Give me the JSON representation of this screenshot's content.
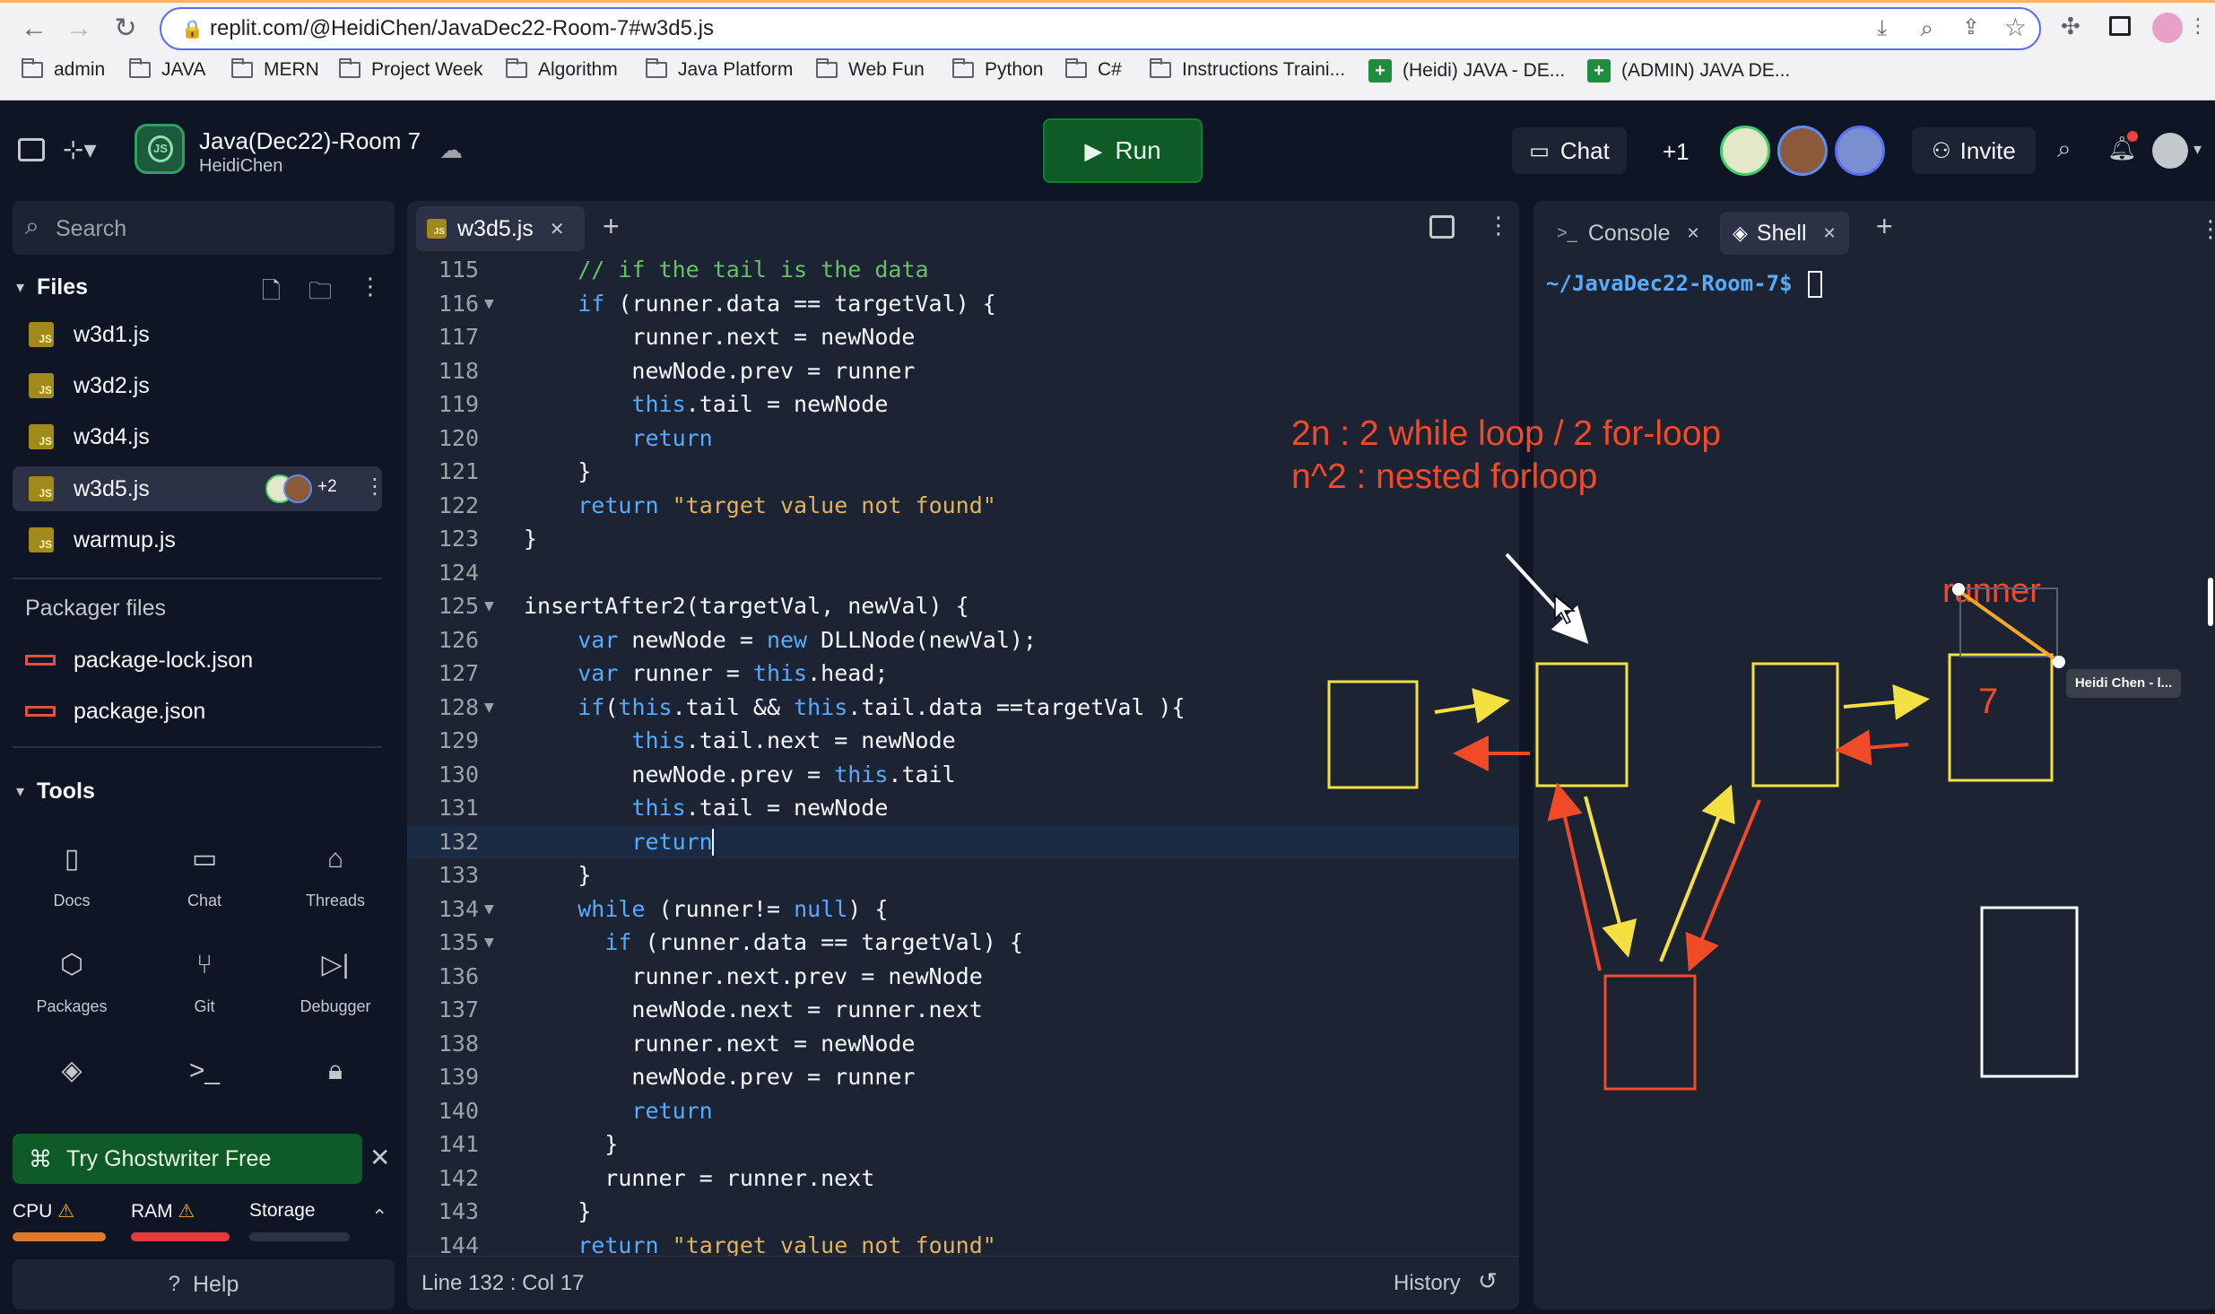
{
  "browser": {
    "url": "replit.com/@HeidiChen/JavaDec22-Room-7#w3d5.js",
    "bookmarks": [
      "admin",
      "JAVA",
      "MERN",
      "Project Week",
      "Algorithm",
      "Java Platform",
      "Web Fun",
      "Python",
      "C#",
      "Instructions Traini...",
      "(Heidi) JAVA - DE...",
      "(ADMIN) JAVA DE..."
    ]
  },
  "header": {
    "repl_name": "Java(Dec22)-Room 7",
    "owner": "HeidiChen",
    "run_label": "Run",
    "chat_label": "Chat",
    "extra_users": "+1",
    "invite_label": "Invite"
  },
  "sidebar": {
    "search_placeholder": "Search",
    "files_label": "Files",
    "files": [
      "w3d1.js",
      "w3d2.js",
      "w3d4.js",
      "w3d5.js",
      "warmup.js"
    ],
    "active_file_badge": "+2",
    "packager_label": "Packager files",
    "packager_files": [
      "package-lock.json",
      "package.json"
    ],
    "tools_label": "Tools",
    "tools": [
      "Docs",
      "Chat",
      "Threads",
      "Packages",
      "Git",
      "Debugger"
    ],
    "ghostwriter_label": "Try Ghostwriter Free",
    "resources": [
      "CPU",
      "RAM",
      "Storage"
    ],
    "help_label": "Help"
  },
  "editor": {
    "tab_label": "w3d5.js",
    "status": "Line 132 : Col 17",
    "history_label": "History",
    "lines": [
      {
        "n": "115",
        "fold": "",
        "code": "    // if the tail is the data"
      },
      {
        "n": "116",
        "fold": "▼",
        "code": "    if (runner.data == targetVal) {"
      },
      {
        "n": "117",
        "fold": "",
        "code": "        runner.next = newNode"
      },
      {
        "n": "118",
        "fold": "",
        "code": "        newNode.prev = runner"
      },
      {
        "n": "119",
        "fold": "",
        "code": "        this.tail = newNode"
      },
      {
        "n": "120",
        "fold": "",
        "code": "        return"
      },
      {
        "n": "121",
        "fold": "",
        "code": "    }"
      },
      {
        "n": "122",
        "fold": "",
        "code": "    return \"target value not found\""
      },
      {
        "n": "123",
        "fold": "",
        "code": "}"
      },
      {
        "n": "124",
        "fold": "",
        "code": ""
      },
      {
        "n": "125",
        "fold": "▼",
        "code": "insertAfter2(targetVal, newVal) {"
      },
      {
        "n": "126",
        "fold": "",
        "code": "    var newNode = new DLLNode(newVal);"
      },
      {
        "n": "127",
        "fold": "",
        "code": "    var runner = this.head;"
      },
      {
        "n": "128",
        "fold": "▼",
        "code": "    if(this.tail && this.tail.data ==targetVal ){"
      },
      {
        "n": "129",
        "fold": "",
        "code": "        this.tail.next = newNode"
      },
      {
        "n": "130",
        "fold": "",
        "code": "        newNode.prev = this.tail"
      },
      {
        "n": "131",
        "fold": "",
        "code": "        this.tail = newNode"
      },
      {
        "n": "132",
        "fold": "",
        "code": "        return"
      },
      {
        "n": "133",
        "fold": "",
        "code": "    }"
      },
      {
        "n": "134",
        "fold": "▼",
        "code": "    while (runner!= null) {"
      },
      {
        "n": "135",
        "fold": "▼",
        "code": "      if (runner.data == targetVal) {"
      },
      {
        "n": "136",
        "fold": "",
        "code": "        runner.next.prev = newNode"
      },
      {
        "n": "137",
        "fold": "",
        "code": "        newNode.next = runner.next"
      },
      {
        "n": "138",
        "fold": "",
        "code": "        runner.next = newNode"
      },
      {
        "n": "139",
        "fold": "",
        "code": "        newNode.prev = runner"
      },
      {
        "n": "140",
        "fold": "",
        "code": "        return"
      },
      {
        "n": "141",
        "fold": "",
        "code": "      }"
      },
      {
        "n": "142",
        "fold": "",
        "code": "      runner = runner.next"
      },
      {
        "n": "143",
        "fold": "",
        "code": "    }"
      },
      {
        "n": "144",
        "fold": "",
        "code": "    return \"target value not found\""
      }
    ]
  },
  "right_panel": {
    "console_tab": "Console",
    "shell_tab": "Shell",
    "prompt": "~/JavaDec22-Room-7$"
  },
  "annotation": {
    "line1": "2n  : 2 while loop / 2 for-loop",
    "line2": "n^2 : nested forloop",
    "runner_label": "runner",
    "node_value": "7",
    "cursor_tag": "Heidi Chen - l..."
  },
  "colors": {
    "run_button": "#0f5b25",
    "ink_red": "#f04a28",
    "ink_yellow": "#f5e041",
    "ink_orange": "#f5a623"
  }
}
